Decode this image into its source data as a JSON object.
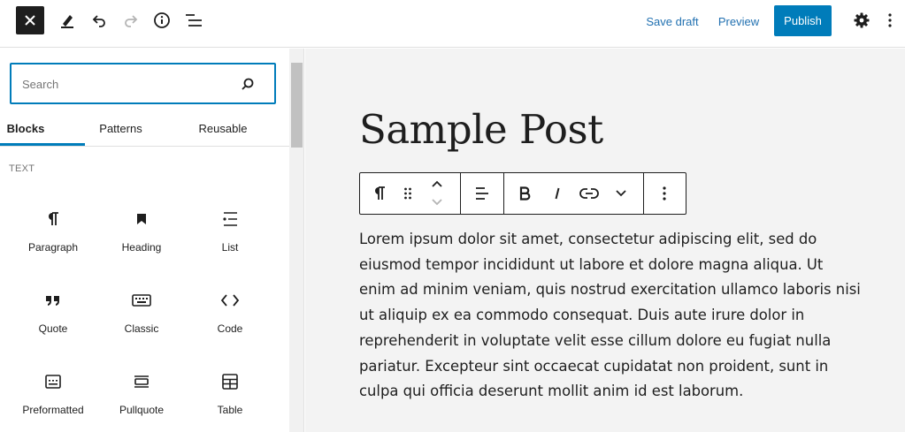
{
  "topbar": {
    "save_draft_label": "Save draft",
    "preview_label": "Preview",
    "publish_label": "Publish",
    "icons": [
      "close-icon",
      "pencil-icon",
      "undo-icon",
      "redo-icon",
      "info-icon",
      "list-view-icon",
      "gear-icon",
      "more-vertical-icon"
    ]
  },
  "inserter": {
    "search_placeholder": "Search",
    "tabs": [
      {
        "label": "Blocks",
        "active": true
      },
      {
        "label": "Patterns",
        "active": false
      },
      {
        "label": "Reusable",
        "active": false
      }
    ],
    "category_label": "TEXT",
    "blocks": [
      {
        "label": "Paragraph",
        "icon": "paragraph-icon"
      },
      {
        "label": "Heading",
        "icon": "heading-icon"
      },
      {
        "label": "List",
        "icon": "list-icon"
      },
      {
        "label": "Quote",
        "icon": "quote-icon"
      },
      {
        "label": "Classic",
        "icon": "keyboard-icon"
      },
      {
        "label": "Code",
        "icon": "code-icon"
      },
      {
        "label": "Preformatted",
        "icon": "preformatted-icon"
      },
      {
        "label": "Pullquote",
        "icon": "pullquote-icon"
      },
      {
        "label": "Table",
        "icon": "table-icon"
      }
    ]
  },
  "canvas": {
    "post_title": "Sample Post",
    "paragraph_text": "Lorem ipsum dolor sit amet, consectetur adipiscing elit, sed do eiusmod tempor incididunt ut labore et dolore magna aliqua. Ut enim ad minim veniam, quis nostrud exercitation ullamco laboris nisi ut aliquip ex ea commodo consequat. Duis aute irure dolor in reprehenderit in voluptate velit esse cillum dolore eu fugiat nulla pariatur. Excepteur sint occaecat cupidatat non proident, sunt in culpa qui officia deserunt mollit anim id est laborum."
  },
  "colors": {
    "accent": "#007cba",
    "link": "#2271b1",
    "dark": "#1e1e1e",
    "canvas_bg": "#f3f3f3"
  }
}
